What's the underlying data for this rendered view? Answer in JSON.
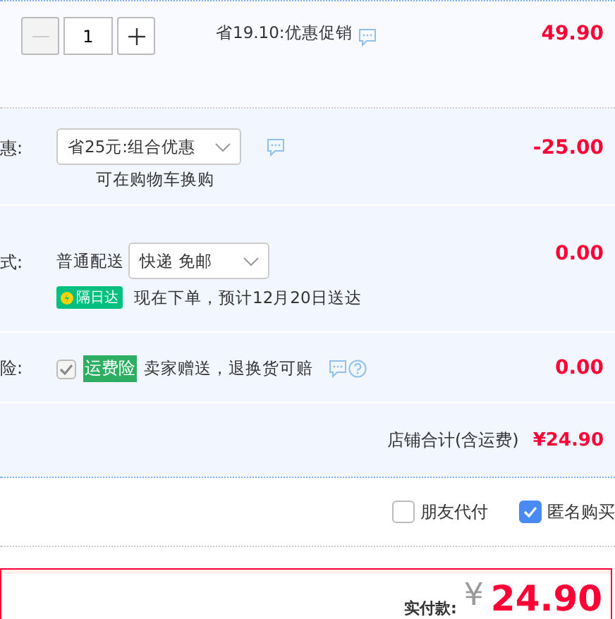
{
  "item": {
    "quantity": "1",
    "minus_disabled": true,
    "promo": "省19.10:优惠促销",
    "price": "49.90"
  },
  "discount": {
    "label": "惠:",
    "selection": "省25元:组合优惠",
    "hint": "可在购物车换购",
    "amount": "-25.00"
  },
  "shipping": {
    "label": "式:",
    "method": "普通配送",
    "selection": "快递 免邮",
    "badge": "隔日达",
    "estimate": "现在下单，预计12月20日送达",
    "amount": "0.00"
  },
  "insurance": {
    "label": "险:",
    "checked": true,
    "disabled": true,
    "tag": "运费险",
    "text": "卖家赠送，退换货可赔",
    "amount": "0.00"
  },
  "shop_total": {
    "label": "店铺合计(含运费)",
    "amount": "¥24.90"
  },
  "options": [
    {
      "label": "朋友代付",
      "checked": false
    },
    {
      "label": "匿名购买",
      "checked": true
    }
  ],
  "payment": {
    "label": "实付款:",
    "currency": "¥",
    "amount": "24.90"
  }
}
